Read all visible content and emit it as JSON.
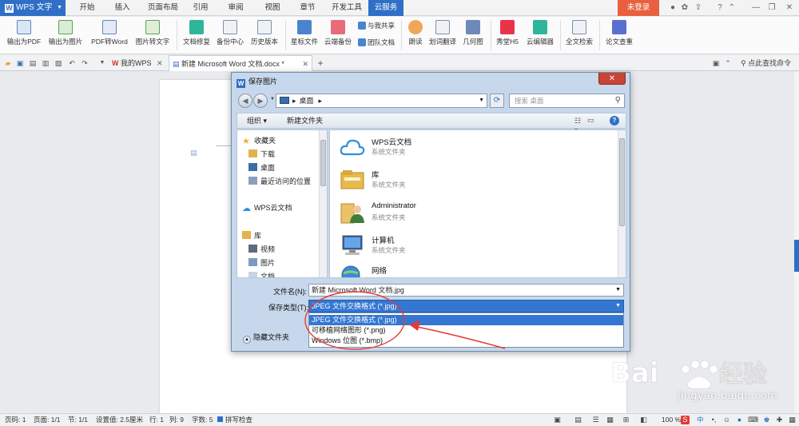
{
  "app": {
    "name": "WPS 文字",
    "login": "未登录"
  },
  "menu_tabs": [
    "开始",
    "插入",
    "页面布局",
    "引用",
    "审阅",
    "视图",
    "章节",
    "开发工具",
    "云服务"
  ],
  "ribbon": {
    "buttons": [
      "输出为PDF",
      "输出为图片",
      "PDF转Word",
      "图片转文字",
      "文档修复",
      "备份中心",
      "历史版本",
      "星标文件",
      "云端备份",
      "朗读",
      "划词翻译",
      "几何图",
      "秀堂H5",
      "云编辑器",
      "全文检索",
      "论文查重"
    ],
    "small": [
      "与我共享",
      "团队文档"
    ]
  },
  "tabs": [
    {
      "label": "我的WPS"
    },
    {
      "label": "新建 Microsoft Word 文档.docx *"
    }
  ],
  "search_command": "点此查找命令",
  "dialog": {
    "title": "保存图片",
    "address": "桌面",
    "search_placeholder": "搜索 桌面",
    "toolbar": {
      "organize": "组织 ▾",
      "new_folder": "新建文件夹"
    },
    "nav": {
      "favorites": "收藏夹",
      "downloads": "下载",
      "desktop": "桌面",
      "recent": "最近访问的位置",
      "wps_cloud": "WPS云文档",
      "library": "库",
      "videos": "视频",
      "pictures": "图片",
      "documents": "文档"
    },
    "files": [
      {
        "name": "WPS云文档",
        "desc": "系统文件夹"
      },
      {
        "name": "库",
        "desc": "系统文件夹"
      },
      {
        "name": "Administrator",
        "desc": "系统文件夹"
      },
      {
        "name": "计算机",
        "desc": "系统文件夹"
      },
      {
        "name": "网络",
        "desc": ""
      }
    ],
    "filename_label": "文件名(N):",
    "filename_value": "新建 Microsoft Word 文档.jpg",
    "type_label": "保存类型(T):",
    "type_value": "JPEG 文件交换格式 (*.jpg)",
    "type_options": [
      "JPEG 文件交换格式 (*.jpg)",
      "可移植网络图形 (*.png)",
      "Windows 位图 (*.bmp)"
    ],
    "hide_folders": "隐藏文件夹"
  },
  "status": {
    "page": "页码: 1",
    "pages": "页面: 1/1",
    "section": "节: 1/1",
    "setting": "设置值: 2.5厘米",
    "row": "行: 1",
    "col": "列: 9",
    "words": "字数: 5",
    "spell": "拼写检查",
    "zoom": "100 %",
    "ime": "中"
  },
  "watermark": {
    "url": "jingyan.baidu.com"
  },
  "colors": {
    "accent": "#2f6fc6",
    "login": "#e9603e",
    "selection": "#3477d3",
    "annotation": "#e53935"
  }
}
